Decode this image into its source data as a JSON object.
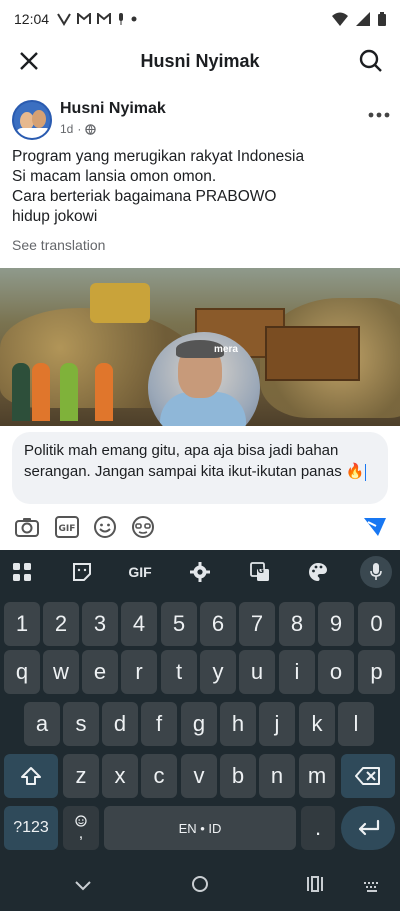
{
  "status_bar": {
    "time": "12:04",
    "notifications": [
      "V-icon",
      "M",
      "M",
      "mic-icon",
      "dot"
    ]
  },
  "header": {
    "title": "Husni Nyimak"
  },
  "post": {
    "author": "Husni Nyimak",
    "time": "1d",
    "lines": [
      "Program yang merugikan rakyat Indonesia",
      "Si macam lansia omon omon.",
      "Cara berteriak bagaimana PRABOWO",
      "hidup jokowi"
    ],
    "see_translation": "See translation",
    "image_caption": "mera"
  },
  "comment": {
    "text": "Politik mah emang gitu, apa aja bisa jadi bahan serangan. Jangan sampai kita ikut-ikutan panas 🔥"
  },
  "keyboard": {
    "toolbar": {
      "gif": "GIF"
    },
    "row_numbers": [
      "1",
      "2",
      "3",
      "4",
      "5",
      "6",
      "7",
      "8",
      "9",
      "0"
    ],
    "row_1": [
      "q",
      "w",
      "e",
      "r",
      "t",
      "y",
      "u",
      "i",
      "o",
      "p"
    ],
    "row_2": [
      "a",
      "s",
      "d",
      "f",
      "g",
      "h",
      "j",
      "k",
      "l"
    ],
    "row_3": [
      "z",
      "x",
      "c",
      "v",
      "b",
      "n",
      "m"
    ],
    "sym_key": "?123",
    "comma_key": ",",
    "space_label": "EN • ID",
    "period_key": "."
  },
  "colors": {
    "accent": "#1877f2",
    "keyboard_bg": "#1f2a30",
    "key_bg": "#3c4449",
    "special_key_bg": "#2f4a5a"
  }
}
